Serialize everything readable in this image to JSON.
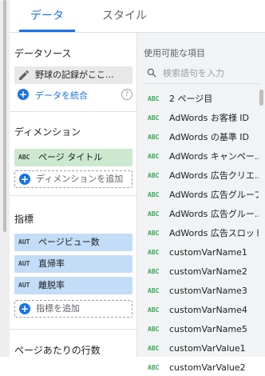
{
  "tabs": [
    {
      "label": "データ",
      "active": true
    },
    {
      "label": "スタイル",
      "active": false
    }
  ],
  "data_source": {
    "title": "データソース",
    "name": "野球の記録がここ...",
    "blend_label": "データを統合",
    "help_icon": "?"
  },
  "dimension": {
    "title": "ディメンション",
    "chips": [
      {
        "type": "ABC",
        "label": "ページ タイトル"
      }
    ],
    "add_label": "ディメンションを追加"
  },
  "metric": {
    "title": "指標",
    "chips": [
      {
        "type": "AUT",
        "label": "ページビュー数"
      },
      {
        "type": "AUT",
        "label": "直帰率"
      },
      {
        "type": "AUT",
        "label": "離脱率"
      }
    ],
    "add_label": "指標を追加"
  },
  "rows_per_page": {
    "title": "ページあたりの行数"
  },
  "available_fields": {
    "title": "使用可能な項目",
    "search_placeholder": "検索語句を入力",
    "items": [
      {
        "type": "ABC",
        "name": "2 ページ目"
      },
      {
        "type": "ABC",
        "name": "AdWords お客様 ID"
      },
      {
        "type": "ABC",
        "name": "AdWords の基準 ID"
      },
      {
        "type": "ABC",
        "name": "AdWords キャンペー..."
      },
      {
        "type": "ABC",
        "name": "AdWords 広告クリエ..."
      },
      {
        "type": "ABC",
        "name": "AdWords 広告グループ"
      },
      {
        "type": "ABC",
        "name": "AdWords 広告グルー..."
      },
      {
        "type": "ABC",
        "name": "AdWords 広告スロット"
      },
      {
        "type": "ABC",
        "name": "customVarName1"
      },
      {
        "type": "ABC",
        "name": "customVarName2"
      },
      {
        "type": "ABC",
        "name": "customVarName3"
      },
      {
        "type": "ABC",
        "name": "customVarName4"
      },
      {
        "type": "ABC",
        "name": "customVarName5"
      },
      {
        "type": "ABC",
        "name": "customVarValue1"
      },
      {
        "type": "ABC",
        "name": "customVarValue2"
      }
    ]
  },
  "colors": {
    "accent": "#1a73e8",
    "dimension_chip": "#cce9d0",
    "metric_chip": "#c3dcf7",
    "field_type": "#34a853"
  }
}
